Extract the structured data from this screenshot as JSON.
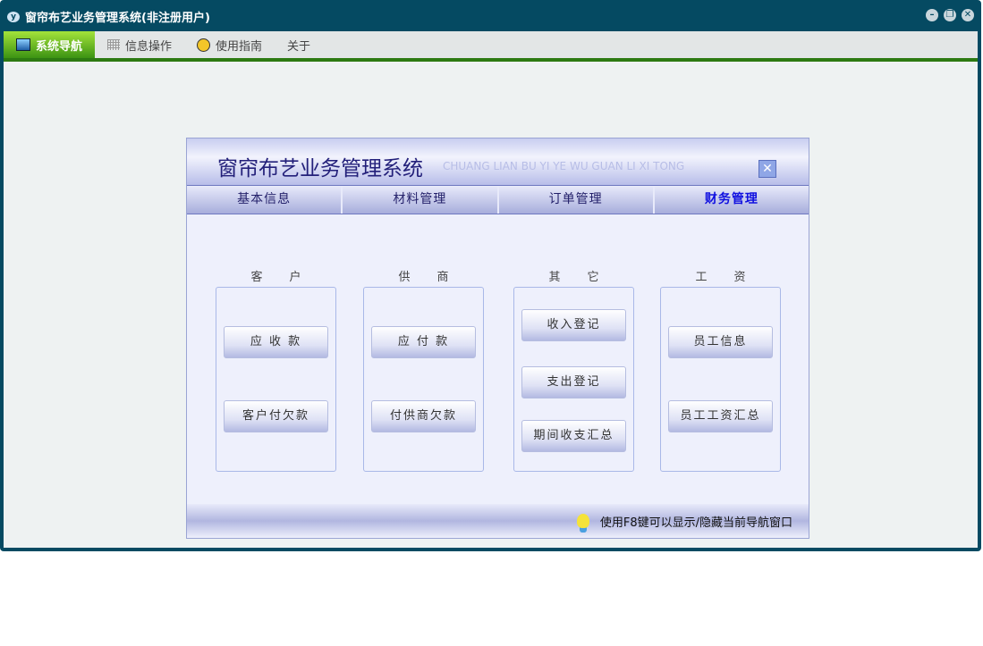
{
  "window": {
    "title": "窗帘布艺业务管理系统(非注册用户)",
    "logo": "y"
  },
  "menu": [
    {
      "label": "系统导航",
      "icon": "monitor-icon"
    },
    {
      "label": "信息操作",
      "icon": "grid-icon"
    },
    {
      "label": "使用指南",
      "icon": "help-icon"
    },
    {
      "label": "关于"
    }
  ],
  "panel": {
    "title": "窗帘布艺业务管理系统",
    "subtitle": "CHUANG LIAN BU YI YE WU GUAN LI XI TONG",
    "tabs": [
      "基本信息",
      "材料管理",
      "订单管理",
      "财务管理"
    ],
    "groups": [
      {
        "label": "客户",
        "buttons": [
          "应 收 款",
          "客户付欠款"
        ]
      },
      {
        "label": "供商",
        "buttons": [
          "应 付 款",
          "付供商欠款"
        ]
      },
      {
        "label": "其它",
        "buttons": [
          "收入登记",
          "支出登记",
          "期间收支汇总"
        ]
      },
      {
        "label": "工资",
        "buttons": [
          "员工信息",
          "员工工资汇总"
        ]
      }
    ],
    "footer": "使用F8键可以显示/隐藏当前导航窗口"
  }
}
